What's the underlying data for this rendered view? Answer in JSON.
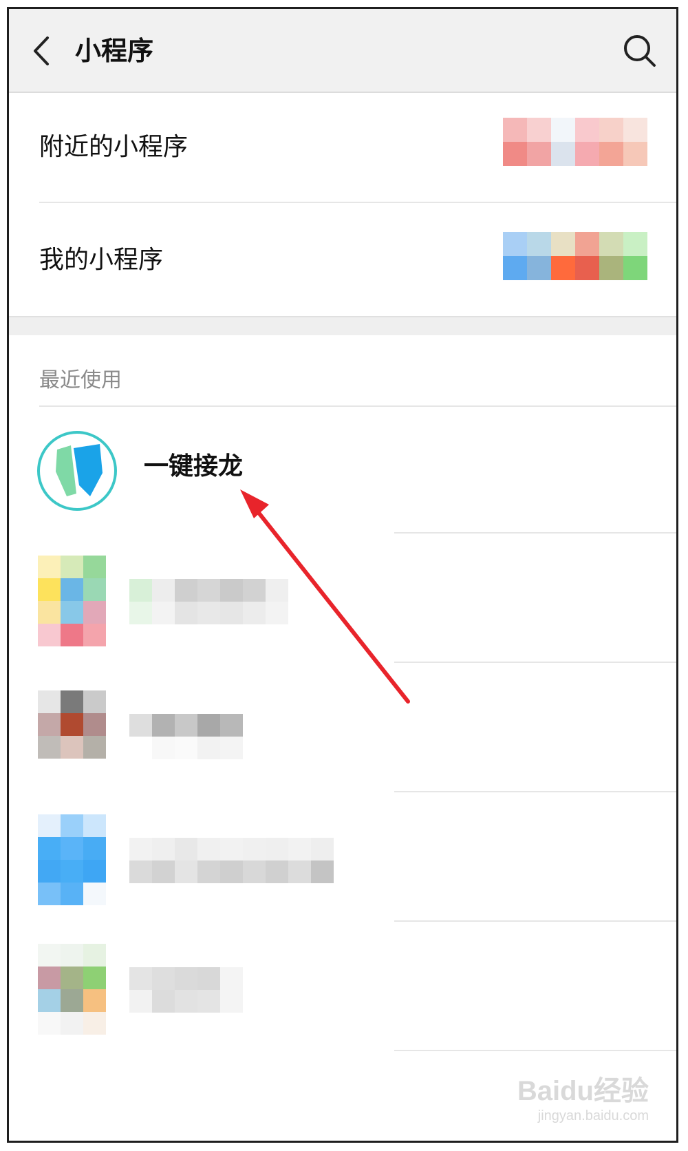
{
  "header": {
    "title": "小程序",
    "back_icon": "back-arrow-icon",
    "search_icon": "search-icon"
  },
  "menu": [
    {
      "label": "附近的小程序"
    },
    {
      "label": "我的小程序"
    }
  ],
  "recent": {
    "section_title": "最近使用",
    "items": [
      {
        "name": "一键接龙",
        "icon": "jielong-logo-icon"
      }
    ]
  },
  "watermark": {
    "main": "Baidu经验",
    "sub": "jingyan.baidu.com"
  },
  "colors": {
    "accent_red": "#e8242b",
    "logo_blue": "#1aa3e8",
    "logo_green": "#7fd9a6",
    "logo_ring": "#3cc7c7"
  }
}
